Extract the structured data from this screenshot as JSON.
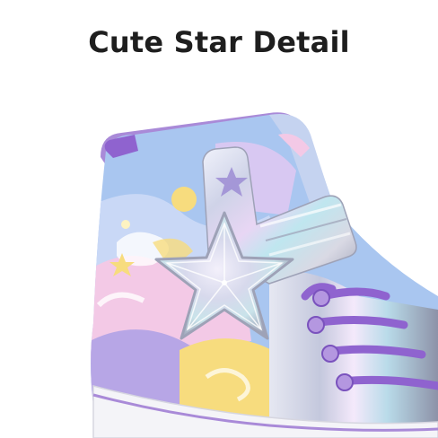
{
  "headline": "Cute Star Detail",
  "image": {
    "subject": "shoe-star-closeup",
    "colors": {
      "background": "#ffffff",
      "headline_text": "#1e1e1e",
      "lavender": "#a98ad8",
      "pastel_blue": "#a9c6f0",
      "pastel_pink": "#f3c9e6",
      "pastel_yellow": "#f7dc7e",
      "holographic_silver": "#cfd3e8",
      "lace_purple": "#8f63cf",
      "sole_white": "#f4f4f8"
    }
  }
}
